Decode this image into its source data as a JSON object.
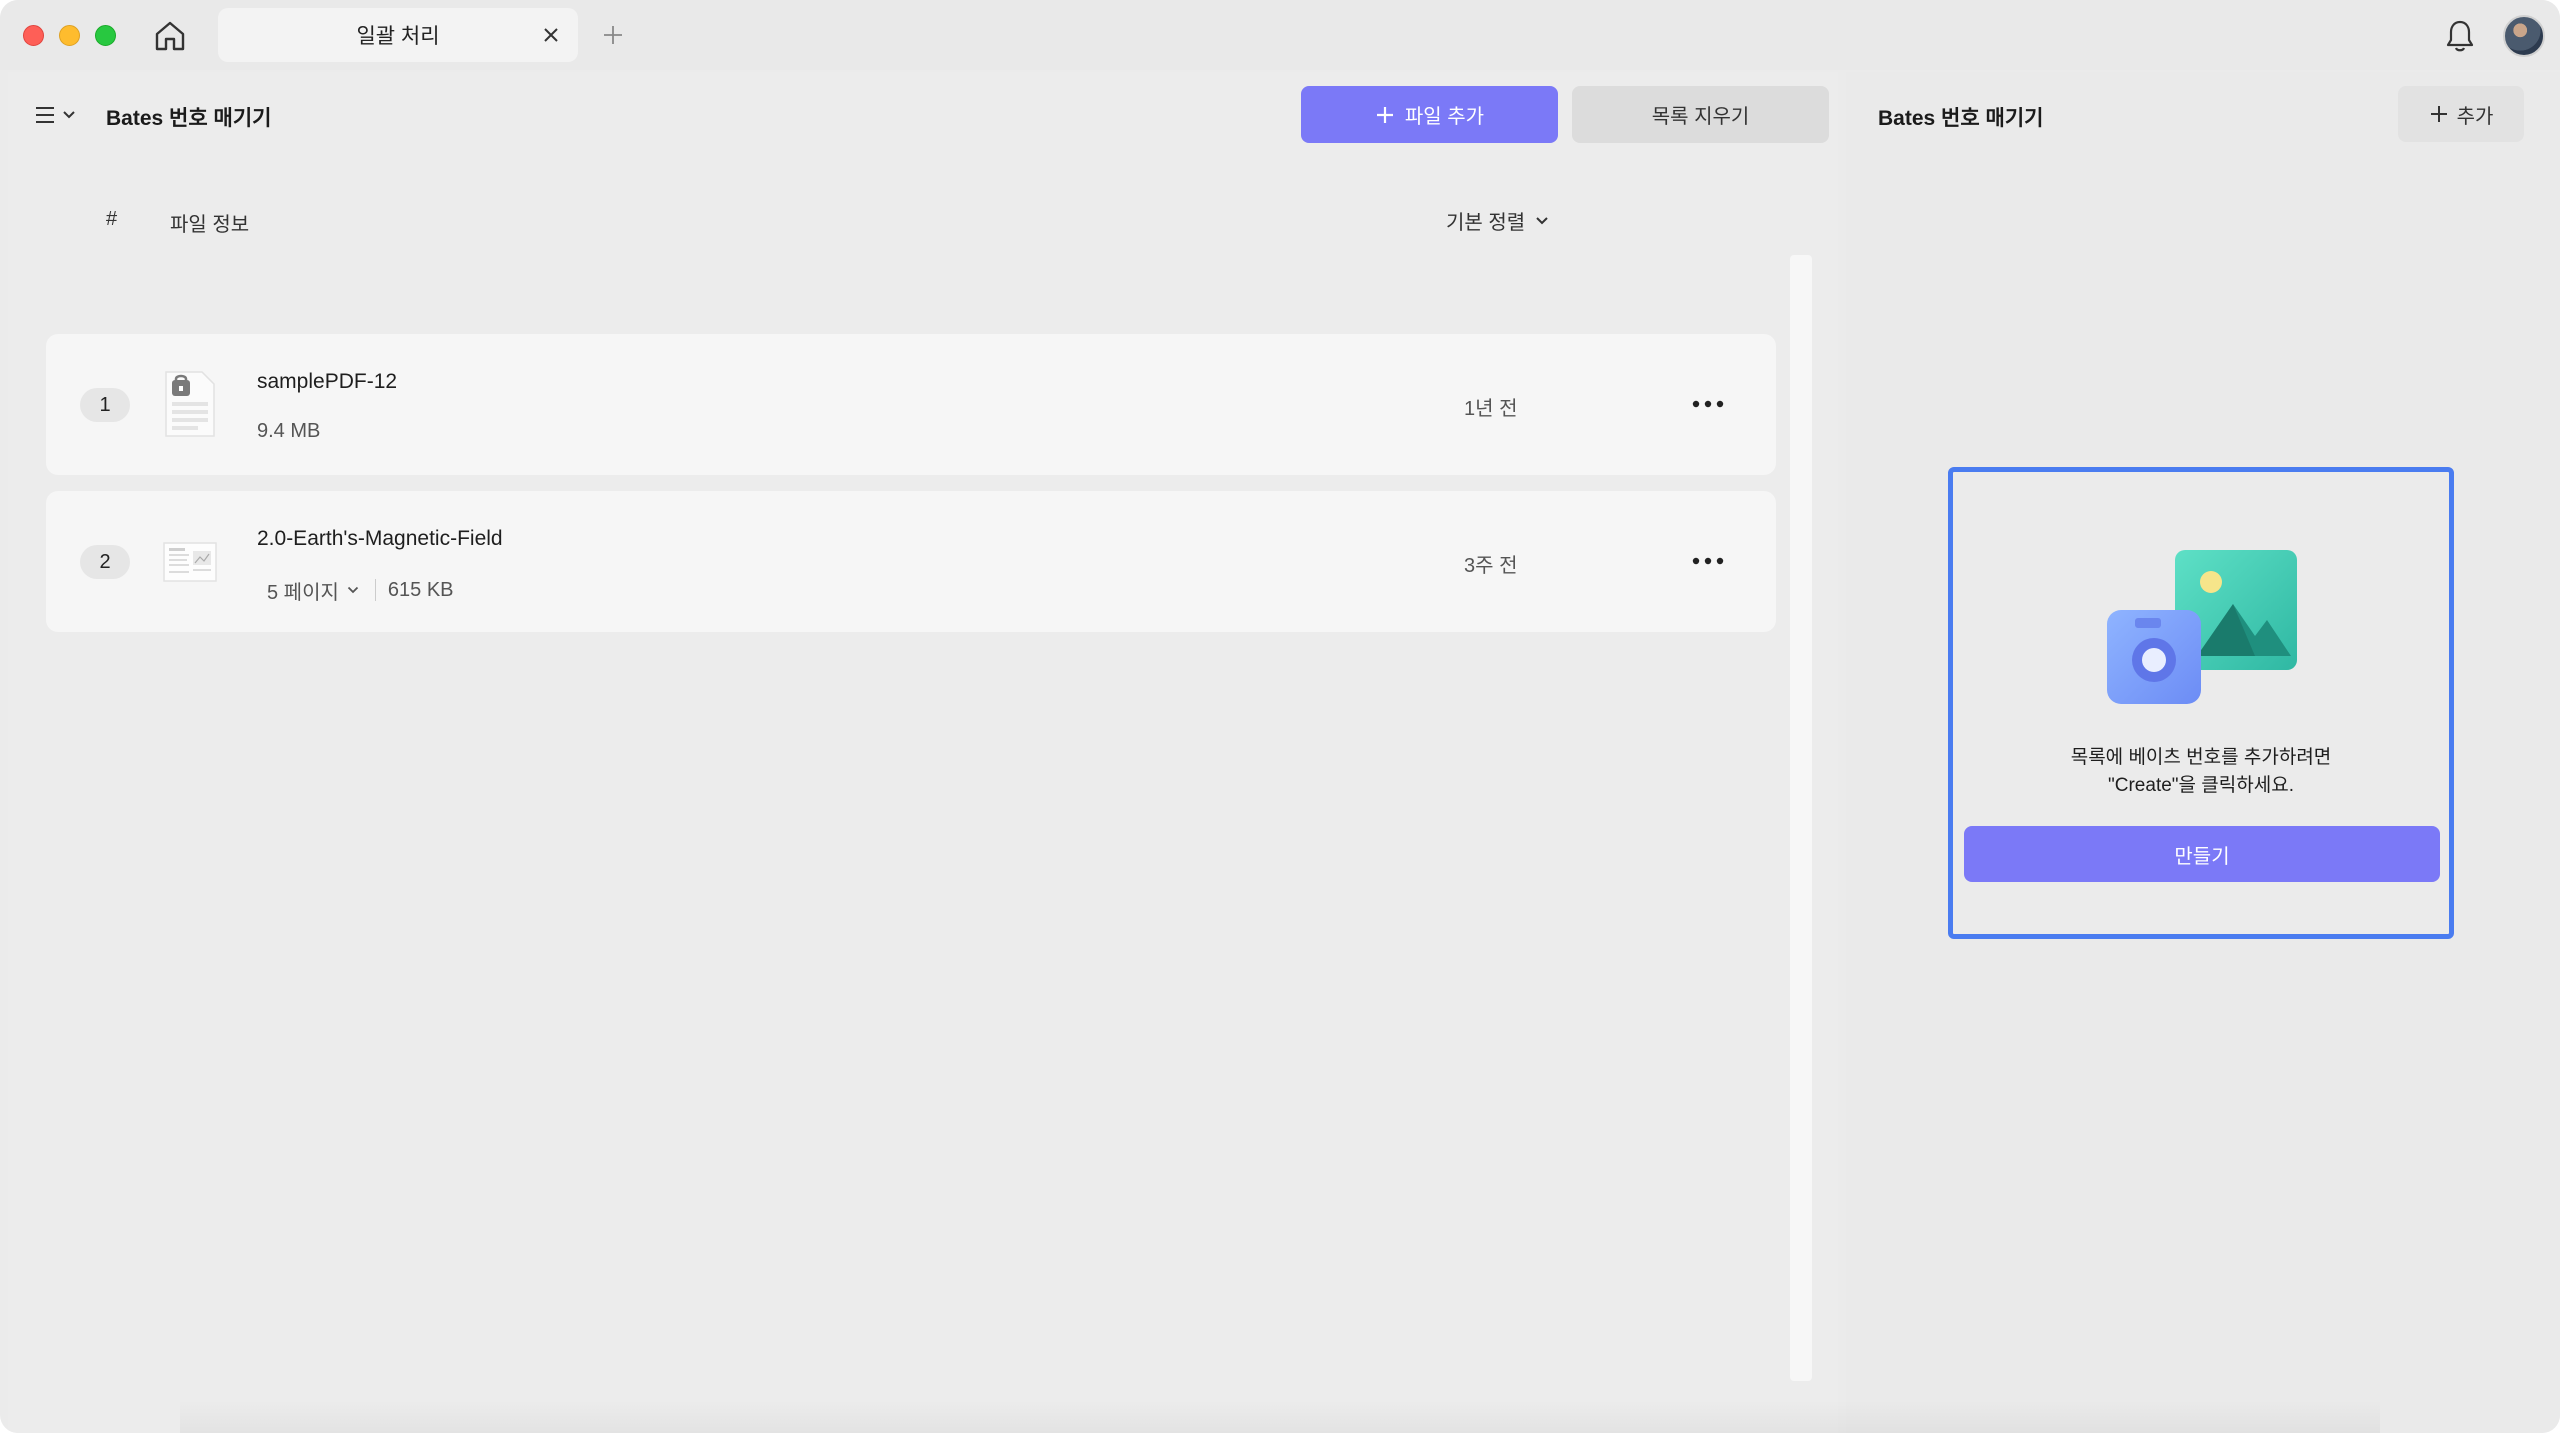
{
  "titlebar": {
    "tab_label": "일괄 처리",
    "tab_close_icon": "close-icon",
    "new_tab_icon": "plus-icon",
    "home_icon": "home-icon",
    "bell_icon": "bell-icon"
  },
  "left": {
    "title": "Bates 번호 매기기",
    "add_file_label": "파일 추가",
    "clear_list_label": "목록 지우기",
    "columns": {
      "number": "#",
      "file_info": "파일 정보"
    },
    "sort_label": "기본 정렬",
    "files": [
      {
        "index": "1",
        "name": "samplePDF-12",
        "size": "9.4 MB",
        "time": "1년 전",
        "locked": true
      },
      {
        "index": "2",
        "name": "2.0-Earth's-Magnetic-Field",
        "pages": "5 페이지",
        "size": "615 KB",
        "time": "3주 전",
        "locked": false
      }
    ]
  },
  "right": {
    "title": "Bates 번호 매기기",
    "add_label": "추가",
    "empty_line1": "목록에 베이츠 번호를 추가하려면",
    "empty_line2": "\"Create\"을 클릭하세요.",
    "create_label": "만들기"
  },
  "colors": {
    "accent": "#7b79f7",
    "focus_border": "#4a7cf0",
    "background": "#ebebeb"
  }
}
